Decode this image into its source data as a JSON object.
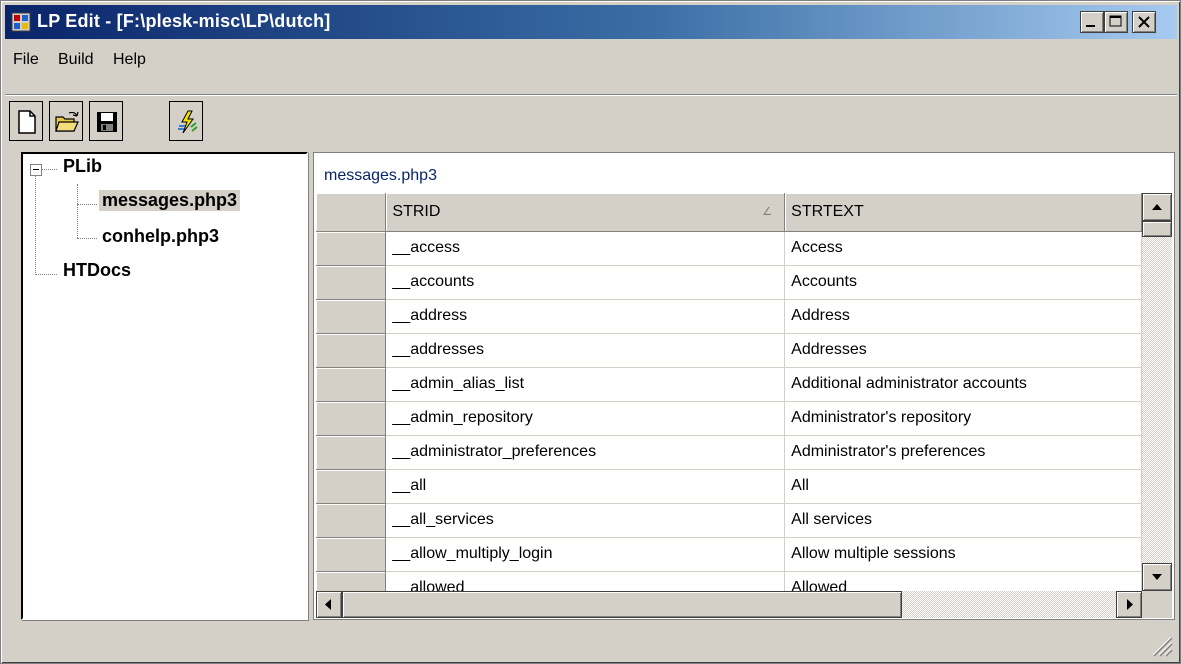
{
  "window": {
    "title": "LP Edit - [F:\\plesk-misc\\LP\\dutch]"
  },
  "menu": {
    "file": "File",
    "build": "Build",
    "help": "Help"
  },
  "toolbar": {
    "icons": [
      "new-file-icon",
      "open-folder-icon",
      "save-disk-icon",
      "build-lightning-icon"
    ]
  },
  "tree": {
    "root": "PLib",
    "children": [
      "messages.php3",
      "conhelp.php3"
    ],
    "sibling": "HTDocs",
    "selected": "messages.php3"
  },
  "panel": {
    "label": "messages.php3"
  },
  "grid": {
    "columns": [
      "STRID",
      "STRTEXT"
    ],
    "rows": [
      {
        "strid": "__access",
        "strtext": "Access"
      },
      {
        "strid": "__accounts",
        "strtext": "Accounts"
      },
      {
        "strid": "__address",
        "strtext": "Address"
      },
      {
        "strid": "__addresses",
        "strtext": "Addresses"
      },
      {
        "strid": "__admin_alias_list",
        "strtext": "Additional administrator accounts"
      },
      {
        "strid": "__admin_repository",
        "strtext": "Administrator's repository"
      },
      {
        "strid": "__administrator_preferences",
        "strtext": "Administrator's preferences"
      },
      {
        "strid": "__all",
        "strtext": "All"
      },
      {
        "strid": "__all_services",
        "strtext": "All services"
      },
      {
        "strid": "__allow_multiply_login",
        "strtext": "Allow multiple sessions"
      },
      {
        "strid": "__allowed",
        "strtext": "Allowed"
      }
    ]
  },
  "colors": {
    "title_gradient_start": "#0a246a",
    "title_gradient_end": "#a6caf0",
    "face": "#d4d0c8",
    "panel_label": "#0a246a"
  }
}
